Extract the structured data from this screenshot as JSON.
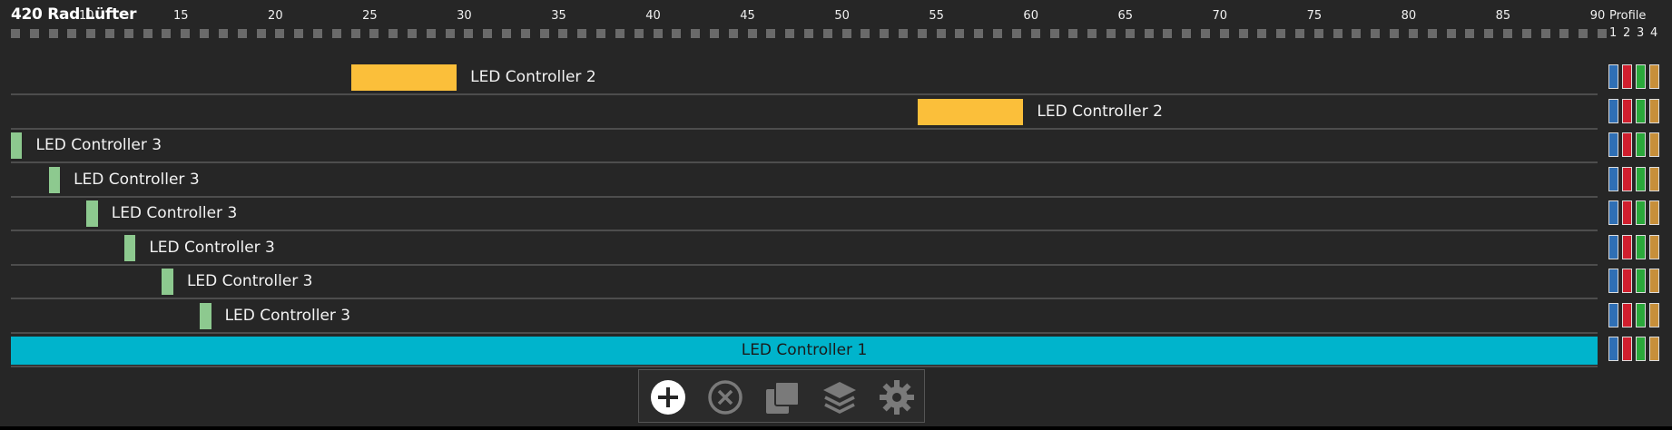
{
  "header": {
    "title": "420 Rad Lüfter",
    "ticks": [
      "10",
      "15",
      "20",
      "25",
      "30",
      "35",
      "40",
      "45",
      "50",
      "55",
      "60",
      "65",
      "70",
      "75",
      "80",
      "85",
      "90"
    ],
    "profile_label": "Profile",
    "profile_numbers": [
      "1",
      "2",
      "3",
      "4"
    ]
  },
  "colors": {
    "background": "#262626",
    "controller_2": "#fbbf3a",
    "controller_3": "#8dc98f",
    "controller_1": "#00b4cc",
    "profile_1": "#2f6fb5",
    "profile_2": "#d01f2e",
    "profile_3": "#2aa83a",
    "profile_4": "#c78f3a"
  },
  "timeline": {
    "min": 6,
    "max": 90,
    "lanes": [
      {
        "label": "LED Controller 2",
        "start": 24.0,
        "end": 29.6,
        "color": "controller_2"
      },
      {
        "label": "LED Controller 2",
        "start": 54.0,
        "end": 59.6,
        "color": "controller_2"
      },
      {
        "label": "LED Controller 3",
        "start": 6.0,
        "end": 6.6,
        "color": "controller_3"
      },
      {
        "label": "LED Controller 3",
        "start": 8.0,
        "end": 8.6,
        "color": "controller_3"
      },
      {
        "label": "LED Controller 3",
        "start": 10.0,
        "end": 10.6,
        "color": "controller_3"
      },
      {
        "label": "LED Controller 3",
        "start": 12.0,
        "end": 12.6,
        "color": "controller_3"
      },
      {
        "label": "LED Controller 3",
        "start": 14.0,
        "end": 14.6,
        "color": "controller_3"
      },
      {
        "label": "LED Controller 3",
        "start": 16.0,
        "end": 16.6,
        "color": "controller_3"
      },
      {
        "label": "LED Controller 1",
        "start": 6.0,
        "end": 90.0,
        "color": "controller_1",
        "full": true
      }
    ]
  },
  "toolbar": {
    "buttons": [
      {
        "name": "add-button",
        "icon": "plus-circle-icon"
      },
      {
        "name": "remove-button",
        "icon": "x-circle-icon"
      },
      {
        "name": "copy-button",
        "icon": "copy-icon"
      },
      {
        "name": "layers-button",
        "icon": "layers-icon"
      },
      {
        "name": "settings-button",
        "icon": "gear-icon"
      }
    ]
  }
}
